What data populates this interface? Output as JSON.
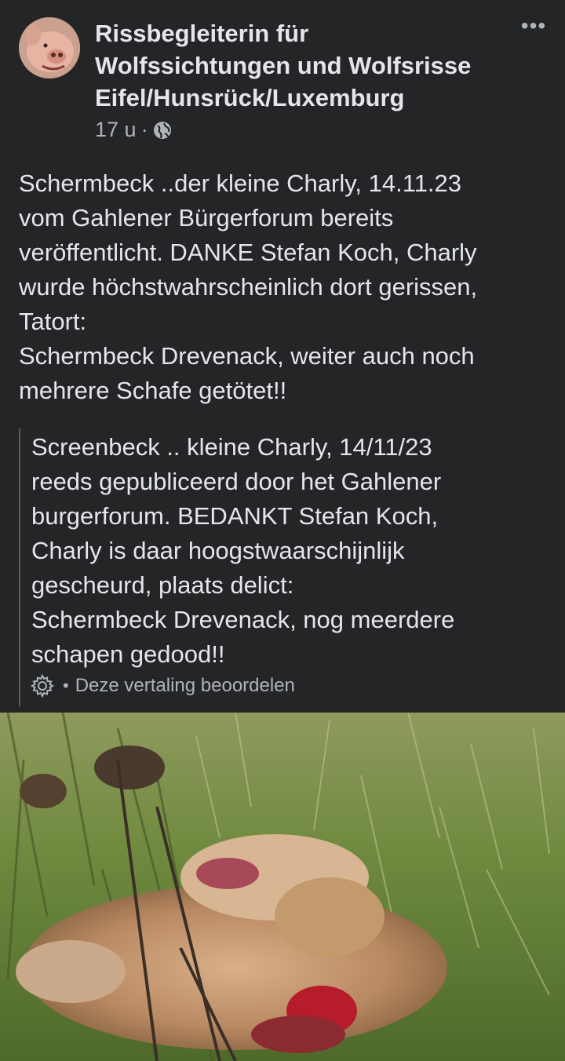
{
  "post": {
    "group_name": "Rissbegleiterin für\nWolfssichtungen und Wolfsrisse\nEifel/Hunsrück/Luxemburg",
    "time_ago": "17 u",
    "separator": "·",
    "more_label": "•••",
    "privacy_icon": "globe-icon",
    "text": "Schermbeck ..der kleine Charly, 14.11.23\nvom Gahlener Bürgerforum bereits\nveröffentlicht. DANKE Stefan Koch, Charly\nwurde höchstwahrscheinlich dort gerissen,\nTatort:\nSchermbeck Drevenack, weiter auch noch\nmehrere Schafe getötet!!"
  },
  "translation": {
    "text": "Screenbeck .. kleine Charly, 14/11/23\nreeds gepubliceerd door het Gahlener\nburgerforum. BEDANKT Stefan Koch,\nCharly is daar hoogstwaarschijnlijk\ngescheurd, plaats delict:\nSchermbeck Drevenack, nog meerdere\nschapen gedood!!",
    "rate_separator": "•",
    "rate_label": "Deze vertaling beoordelen",
    "settings_icon": "gear-icon"
  },
  "colors": {
    "background": "#242526",
    "primary_text": "#e4e6eb",
    "secondary_text": "#b0b3b8"
  }
}
